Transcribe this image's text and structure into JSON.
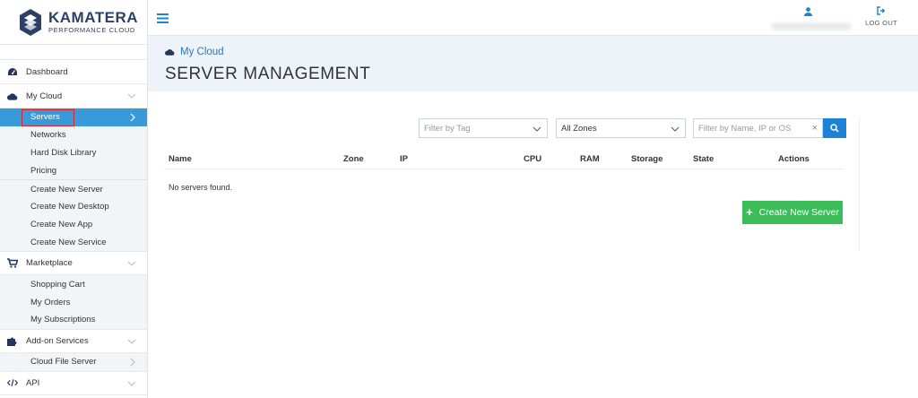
{
  "brand": {
    "name": "KAMATERA",
    "tagline": "PERFORMANCE CLOUD"
  },
  "sidebar": {
    "dashboard": {
      "label": "Dashboard",
      "icon": "dashboard-icon"
    },
    "my_cloud": {
      "label": "My Cloud",
      "icon": "cloud-icon",
      "items": [
        "Servers",
        "Networks",
        "Hard Disk Library",
        "Pricing"
      ],
      "create_items": [
        "Create New Server",
        "Create New Desktop",
        "Create New App",
        "Create New Service"
      ]
    },
    "marketplace": {
      "label": "Marketplace",
      "icon": "cart-icon",
      "items": [
        "Shopping Cart",
        "My Orders",
        "My Subscriptions"
      ]
    },
    "addons": {
      "label": "Add-on Services",
      "icon": "puzzle-icon",
      "items": [
        "Cloud File Server"
      ]
    },
    "api": {
      "label": "API",
      "icon": "code-icon"
    }
  },
  "topbar": {
    "logout_label": "LOG OUT"
  },
  "header": {
    "breadcrumb": "My Cloud",
    "title": "SERVER MANAGEMENT"
  },
  "filters": {
    "tag_placeholder": "Filter by Tag",
    "zone_value": "All Zones",
    "search_placeholder": "Filter by Name, IP or OS",
    "clear_symbol": "×"
  },
  "table": {
    "columns": [
      "Name",
      "Zone",
      "IP",
      "CPU",
      "RAM",
      "Storage",
      "State",
      "Actions"
    ],
    "empty_message": "No servers found."
  },
  "actions": {
    "create_server_label": "Create New Server"
  },
  "colors": {
    "accent": "#3a9ad9",
    "brand": "#2c3f66",
    "success": "#3dbd5a",
    "search": "#1b82d6",
    "header_bg": "#edf3f9"
  }
}
